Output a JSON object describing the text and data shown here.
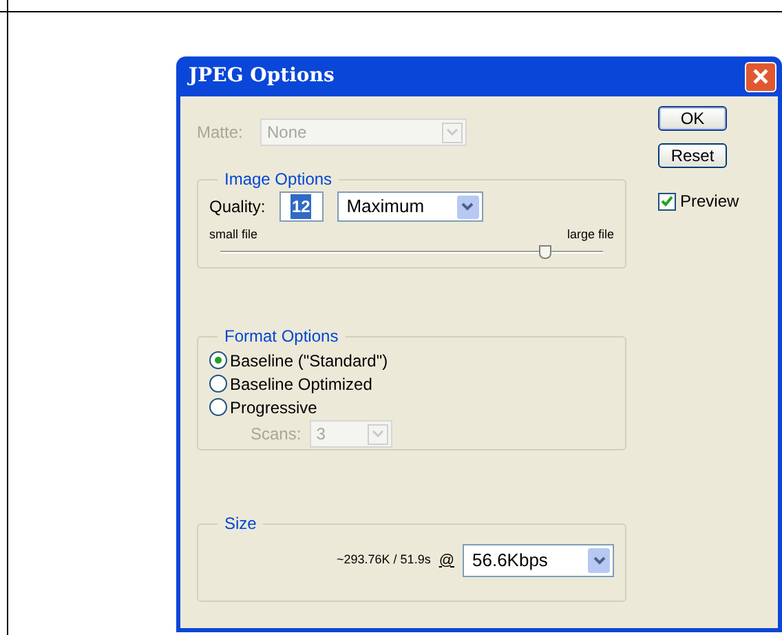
{
  "window": {
    "title": "JPEG Options"
  },
  "matte": {
    "label": "Matte:",
    "value": "None",
    "disabled": true
  },
  "image_options": {
    "title": "Image Options",
    "quality_label": "Quality:",
    "quality_value": "12",
    "quality_preset": "Maximum",
    "slider_min_label": "small file",
    "slider_max_label": "large file",
    "level": 0.85
  },
  "format_options": {
    "title": "Format Options",
    "choices": [
      {
        "label": "Baseline (\"Standard\")",
        "selected": true
      },
      {
        "label": "Baseline Optimized",
        "selected": false
      },
      {
        "label": "Progressive",
        "selected": false
      }
    ],
    "scans": {
      "label": "Scans:",
      "value": "3",
      "disabled": true
    }
  },
  "size": {
    "title": "Size",
    "estimate": "~293.76K / 51.9s",
    "at": "@",
    "speed": "56.6Kbps"
  },
  "buttons": [
    "OK",
    "Reset"
  ],
  "preview": {
    "label": "Preview",
    "checked": true
  }
}
